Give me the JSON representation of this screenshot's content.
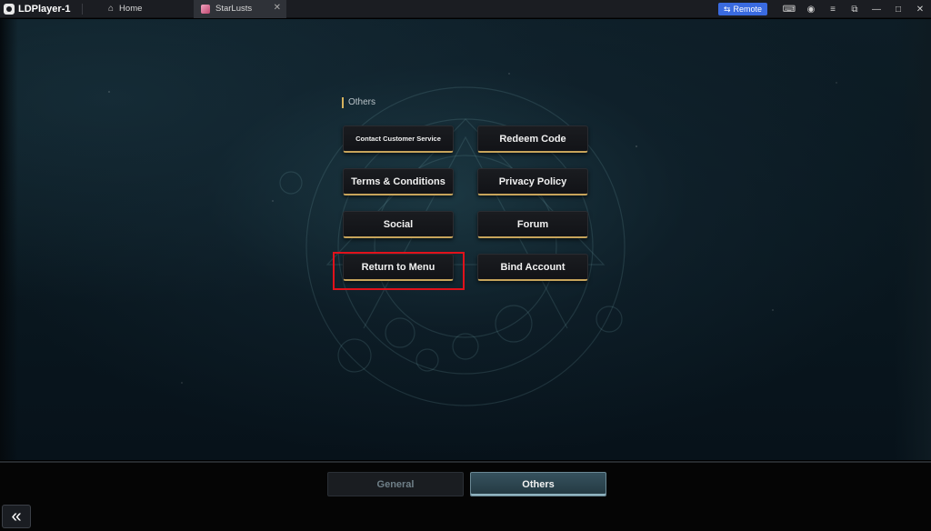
{
  "titlebar": {
    "app_name": "LDPlayer-1",
    "home_tab": "Home",
    "game_tab": "StarLusts",
    "remote_label": "Remote"
  },
  "menu": {
    "section_label": "Others",
    "buttons": [
      "Contact Customer Service",
      "Redeem Code",
      "Terms & Conditions",
      "Privacy Policy",
      "Social",
      "Forum",
      "Return to Menu",
      "Bind Account"
    ]
  },
  "bottom_tabs": {
    "general": "General",
    "others": "Others",
    "selected": "Others"
  },
  "colors": {
    "accent_gold": "#c7a45b",
    "highlight_red": "#e0121b",
    "remote_blue": "#3a6be0"
  }
}
